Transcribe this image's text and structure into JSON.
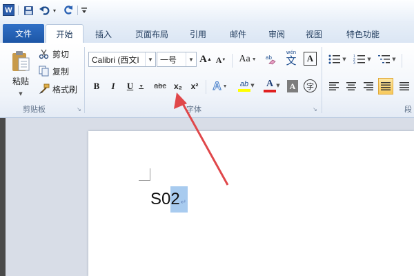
{
  "qat": {
    "icons": [
      "word-logo",
      "save-icon",
      "undo-icon",
      "redo-icon",
      "customize-icon"
    ],
    "logo_letter": "W",
    "undo_dropdown": "▾"
  },
  "tabs": {
    "file": "文件",
    "items": [
      "开始",
      "插入",
      "页面布局",
      "引用",
      "邮件",
      "审阅",
      "视图",
      "特色功能"
    ],
    "active": "开始"
  },
  "clipboard": {
    "paste": "粘贴",
    "cut": "剪切",
    "copy": "复制",
    "format_painter": "格式刷",
    "group_label": "剪贴板"
  },
  "font": {
    "font_name": "Calibri (西文I",
    "font_size": "一号",
    "grow": "A",
    "shrink": "A",
    "change_case": "Aa",
    "clear_format": "",
    "phonetic": "wén",
    "phonetic_char": "文",
    "char_border": "A",
    "bold": "B",
    "italic": "I",
    "underline": "U",
    "strike": "abc",
    "subscript": "x₂",
    "superscript": "x²",
    "text_effect": "A",
    "highlight": "ab",
    "font_color": "A",
    "char_shading": "A",
    "enclose": "字",
    "group_label": "字体"
  },
  "paragraph": {
    "group_label": "段"
  },
  "document": {
    "text_normal": "S0",
    "text_selected": "2",
    "paragraph_mark": "↵"
  },
  "colors": {
    "file_tab": "#1d56a6",
    "selection": "#a8cbef",
    "arrow": "#e0474a",
    "highlight": "#ffff00",
    "font_color": "#e02020"
  }
}
